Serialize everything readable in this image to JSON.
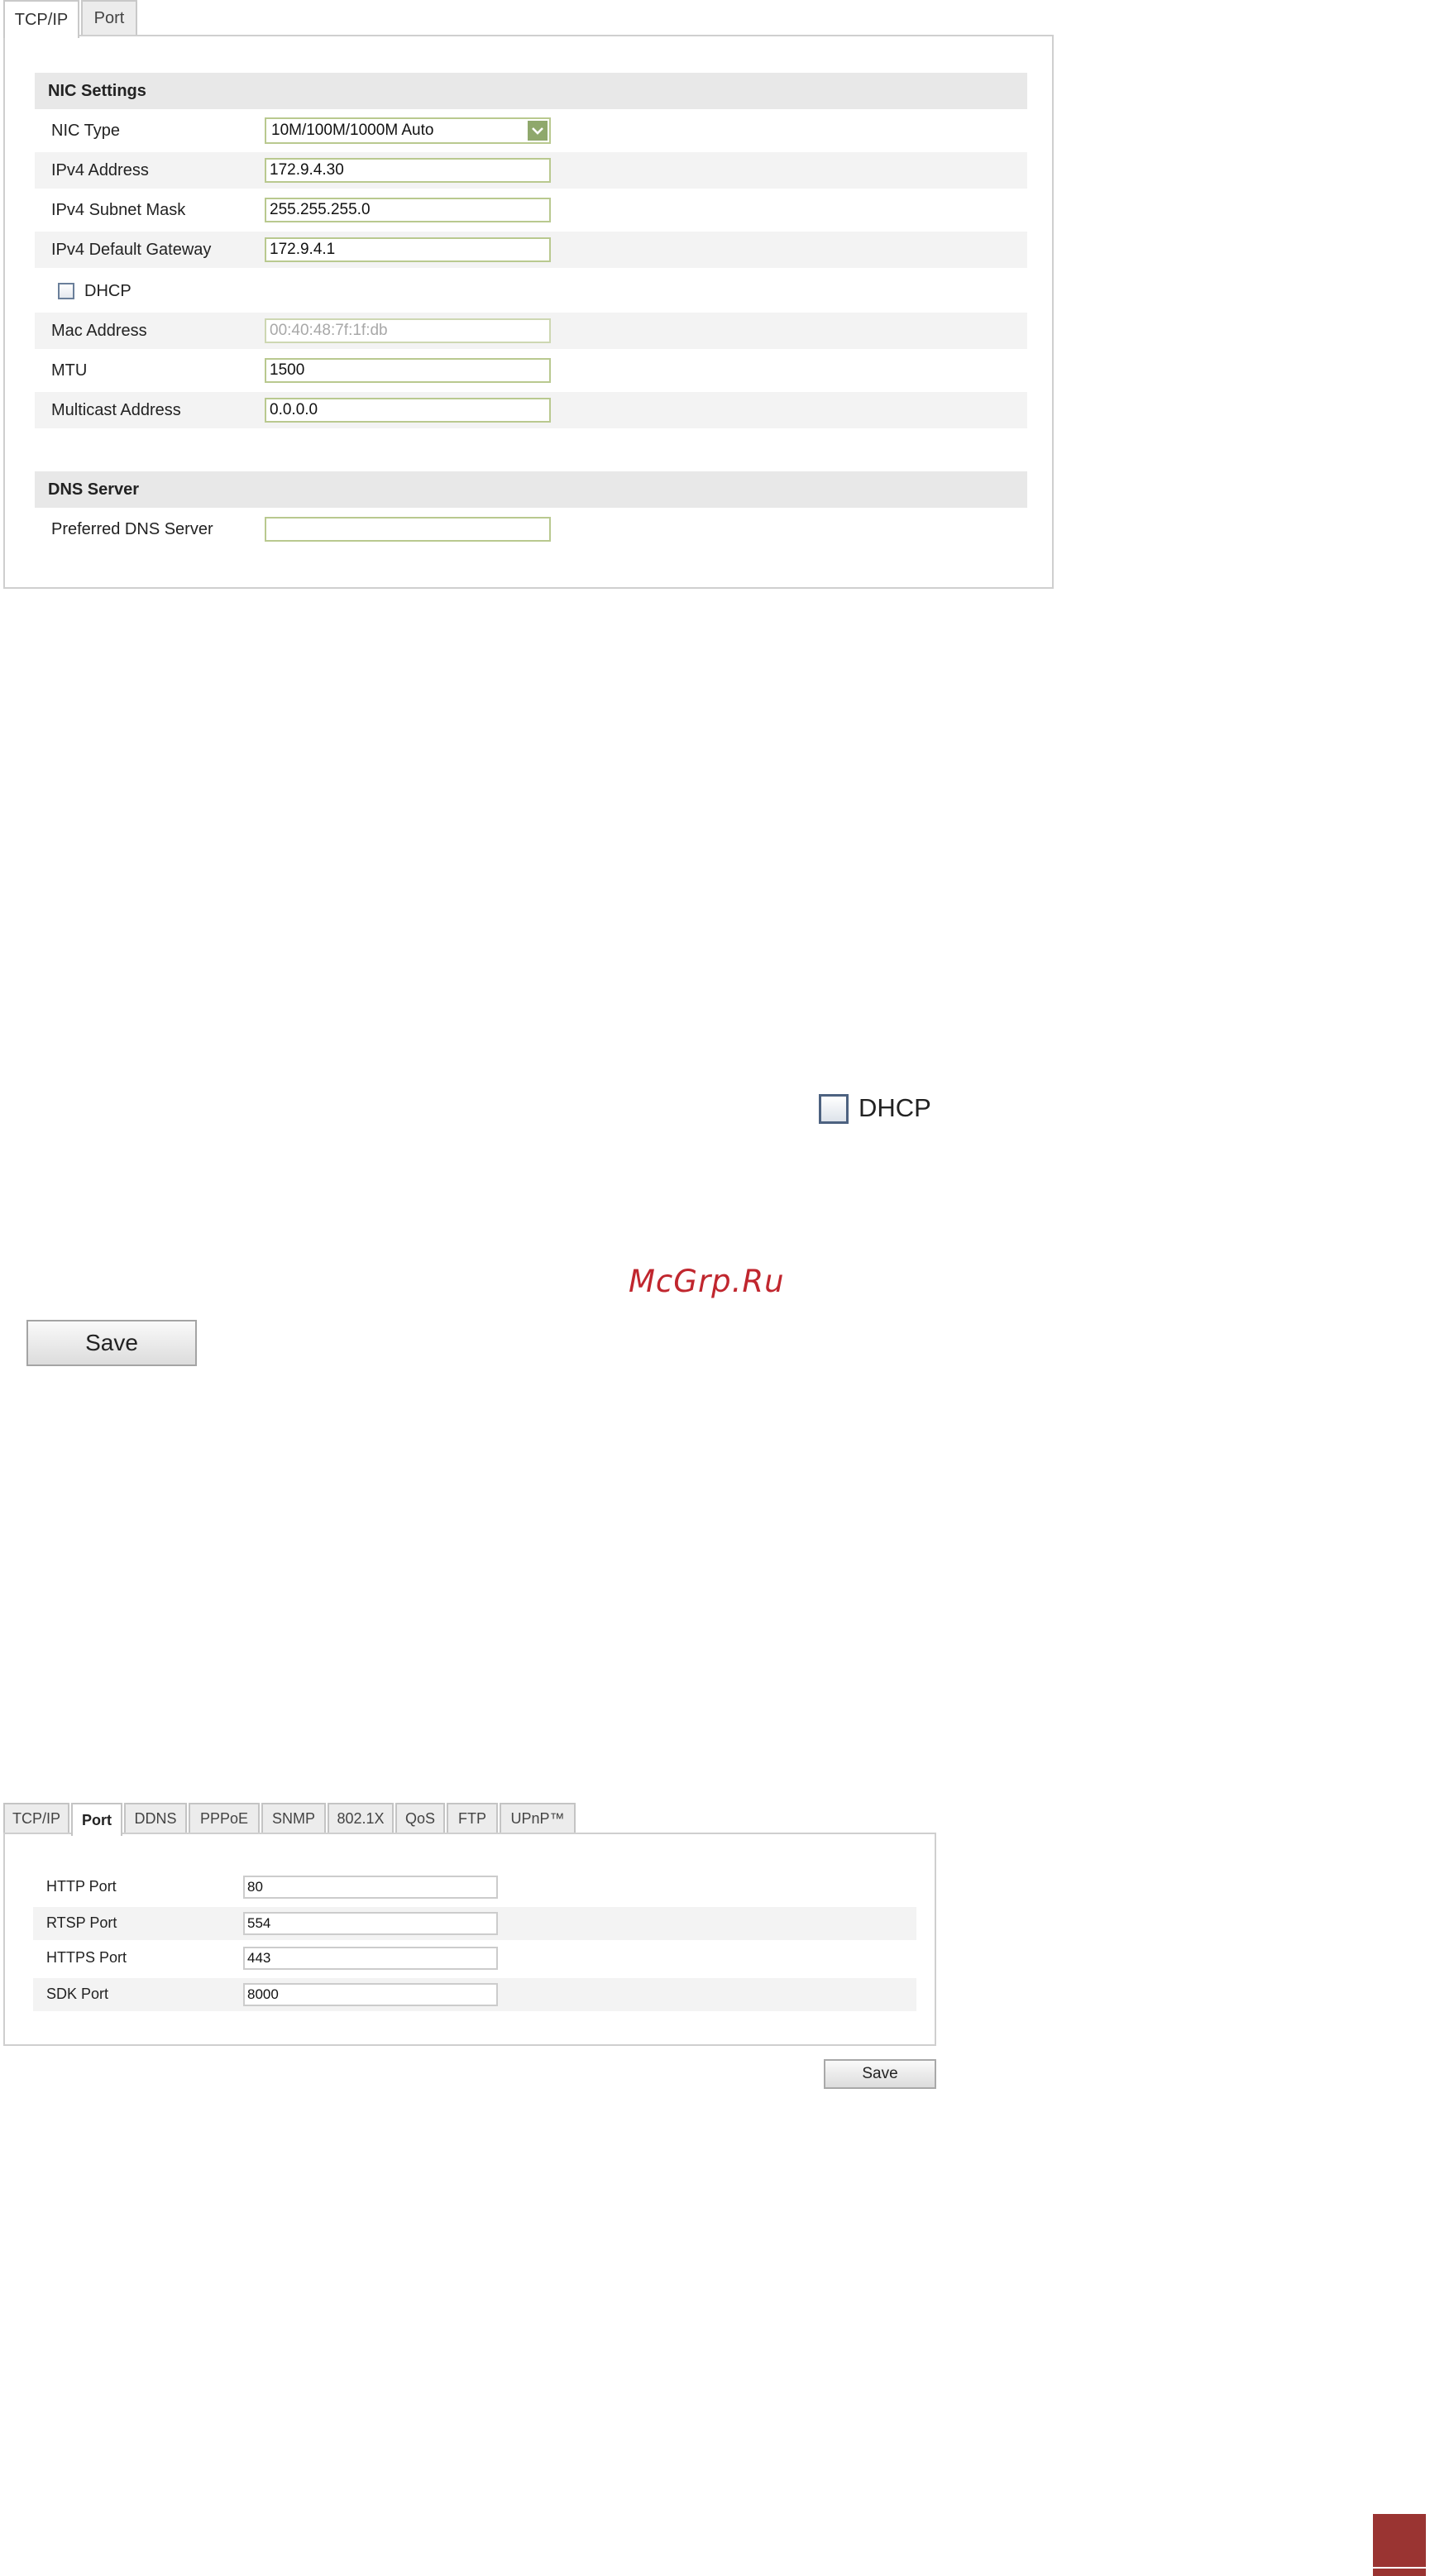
{
  "tcpip_panel": {
    "tabs": [
      {
        "label": "TCP/IP",
        "active": true
      },
      {
        "label": "Port",
        "active": false
      }
    ],
    "nic_section_title": "NIC Settings",
    "nic_type": {
      "label": "NIC Type",
      "value": "10M/100M/1000M Auto"
    },
    "ipv4_address": {
      "label": "IPv4 Address",
      "value": "172.9.4.30"
    },
    "ipv4_subnet_mask": {
      "label": "IPv4 Subnet Mask",
      "value": "255.255.255.0"
    },
    "ipv4_default_gateway": {
      "label": "IPv4 Default Gateway",
      "value": "172.9.4.1"
    },
    "dhcp": {
      "label": "DHCP",
      "checked": false
    },
    "mac_address": {
      "label": "Mac Address",
      "value": "00:40:48:7f:1f:db"
    },
    "mtu": {
      "label": "MTU",
      "value": "1500"
    },
    "multicast_address": {
      "label": "Multicast Address",
      "value": "0.0.0.0"
    },
    "dns_section_title": "DNS Server",
    "preferred_dns": {
      "label": "Preferred DNS Server",
      "value": ""
    }
  },
  "dhcp_enlarged": {
    "label": "DHCP",
    "checked": false
  },
  "watermark": "McGrp.Ru",
  "big_save_label": "Save",
  "port_panel": {
    "tabs": [
      {
        "label": "TCP/IP",
        "active": false
      },
      {
        "label": "Port",
        "active": true
      },
      {
        "label": "DDNS",
        "active": false
      },
      {
        "label": "PPPoE",
        "active": false
      },
      {
        "label": "SNMP",
        "active": false
      },
      {
        "label": "802.1X",
        "active": false
      },
      {
        "label": "QoS",
        "active": false
      },
      {
        "label": "FTP",
        "active": false
      },
      {
        "label": "UPnP™",
        "active": false
      }
    ],
    "http_port": {
      "label": "HTTP Port",
      "value": "80"
    },
    "rtsp_port": {
      "label": "RTSP Port",
      "value": "554"
    },
    "https_port": {
      "label": "HTTPS Port",
      "value": "443"
    },
    "sdk_port": {
      "label": "SDK Port",
      "value": "8000"
    },
    "save_label": "Save"
  },
  "colors": {
    "field_border": "#b9c98f",
    "select_arrow": "#8fa86c",
    "watermark": "#c0262e",
    "corner_marker": "#9a3432"
  }
}
